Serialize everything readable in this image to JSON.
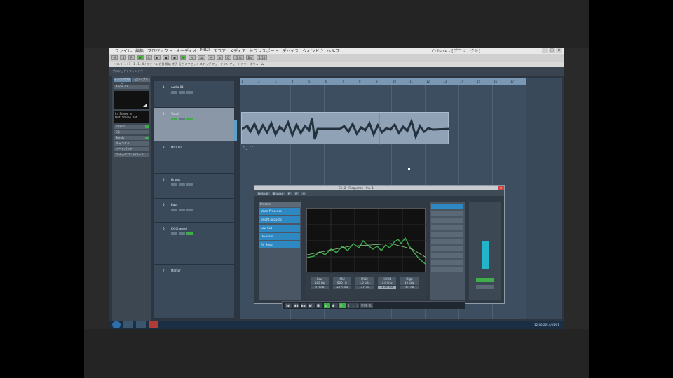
{
  "titlebar": {
    "menus": [
      "ファイル",
      "編集",
      "プロジェクト",
      "オーディオ",
      "MIDI",
      "スコア",
      "メディア",
      "トランスポート",
      "デバイス",
      "ウィンドウ",
      "ヘルプ"
    ],
    "title": "Cubase - [プロジェクト]"
  },
  "toolbar": {
    "buttons": [
      "M",
      "S",
      "R",
      "W",
      "A",
      "▶",
      "■",
      "●",
      "⟲",
      "✎",
      "⌫",
      "✂",
      "⊕",
      "Q",
      "Grid",
      "Bar",
      "1/16"
    ]
  },
  "infoline": {
    "text": "イベント 1 : 1 . 1 . 1 . 0 / ファイル 名前 開始 終了 長さ オフセット スナップ フェードイン フェードアウト ボリューム"
  },
  "infoline2": {
    "text": "プロジェクトウィンドウ"
  },
  "inspector": {
    "tabs": [
      "インスペクター",
      "ビジュアル"
    ],
    "rows": [
      "Audio 01",
      "Inserts",
      "EQ",
      "Sends",
      "チャンネル",
      "ノートパッド",
      "クイックコントロール"
    ],
    "info": [
      "In: Stereo In",
      "Out: Stereo Out"
    ]
  },
  "tracks": [
    {
      "num": "1",
      "name": "Audio 01"
    },
    {
      "num": "2",
      "name": "Vocal"
    },
    {
      "num": "3",
      "name": "MIDI 01"
    },
    {
      "num": "4",
      "name": "Drums"
    },
    {
      "num": "5",
      "name": "Bass"
    },
    {
      "num": "6",
      "name": "FX Channel"
    },
    {
      "num": "7",
      "name": "Marker"
    }
  ],
  "ruler": {
    "ticks": [
      "1",
      "2",
      "3",
      "4",
      "5",
      "6",
      "7",
      "8",
      "9",
      "10",
      "11",
      "12",
      "13",
      "14",
      "15",
      "16",
      "17"
    ]
  },
  "plugin": {
    "title": "Ch. 2 - Frequency - Ins. 1",
    "bar": [
      "Default",
      "Bypass",
      "R",
      "W",
      "≡"
    ],
    "preset_header": "Presets",
    "presets": [
      "Vocal Presence",
      "Bright Acoustic",
      "Low Cut",
      "De-esser",
      "Air Boost"
    ],
    "knobs": [
      [
        "Low",
        "100 Hz",
        "0.0 dB"
      ],
      [
        "Mid",
        "500 Hz",
        "+1.5 dB"
      ],
      [
        "Mid2",
        "1.2 kHz",
        "-2.0 dB"
      ],
      [
        "Hi-Mid",
        "4.0 kHz",
        "+3.0 dB"
      ],
      [
        "High",
        "12 kHz",
        "0.0 dB"
      ]
    ]
  },
  "transport": [
    "|◀",
    "◀◀",
    "▶▶",
    "▶|",
    "■",
    "▶",
    "●",
    "⟳",
    "1 . 1 . 1",
    "0:00:00"
  ],
  "taskbar": {
    "tray": "12:00  2014/01/01"
  }
}
